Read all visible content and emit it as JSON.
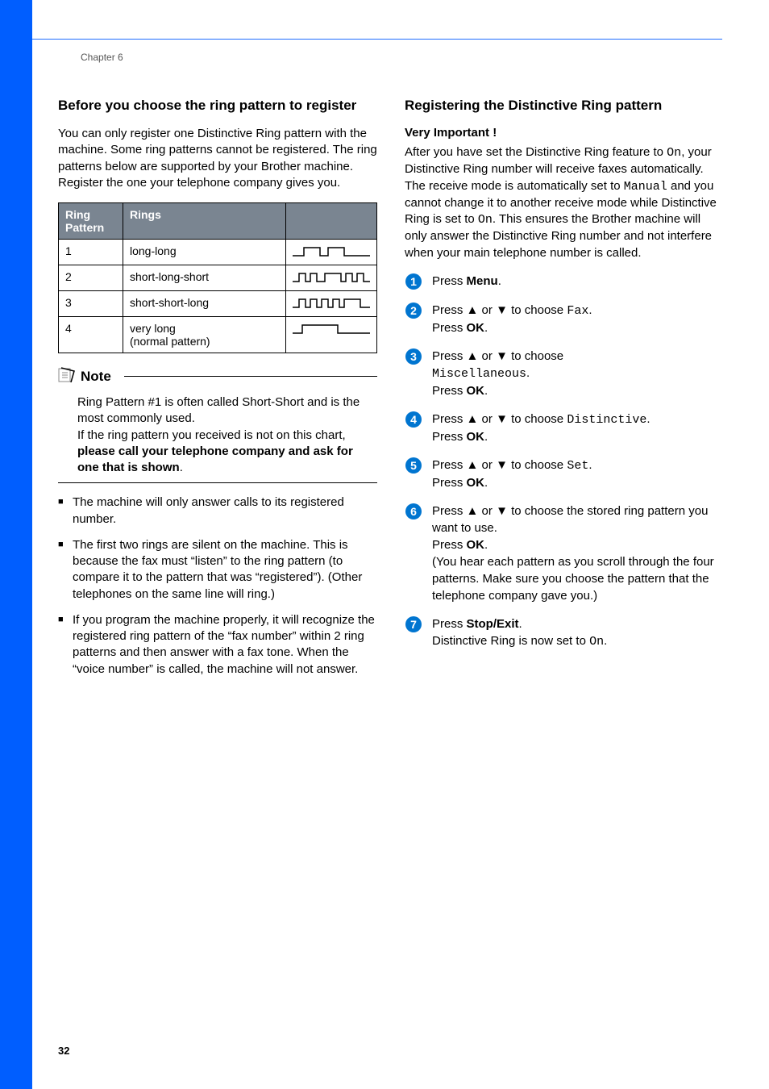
{
  "chapter": "Chapter 6",
  "page_number": "32",
  "left": {
    "heading": "Before you choose the ring pattern to register",
    "intro": "You can only register one Distinctive Ring pattern with the machine. Some ring patterns cannot be registered. The ring patterns below are supported by your Brother machine. Register the one your telephone company gives you.",
    "table": {
      "head_ring_pattern": "Ring Pattern",
      "head_rings": "Rings",
      "rows": [
        {
          "num": "1",
          "rings": "long-long"
        },
        {
          "num": "2",
          "rings": "short-long-short"
        },
        {
          "num": "3",
          "rings": "short-short-long"
        },
        {
          "num": "4",
          "rings": "very long\n(normal pattern)"
        }
      ]
    },
    "note": {
      "title": "Note",
      "line1": "Ring Pattern #1 is often called Short-Short and is the most commonly used.",
      "line2_pre": "If the ring pattern you received is not on this chart, ",
      "line2_bold": "please call your telephone company and ask for one that is shown",
      "line2_post": "."
    },
    "bullets": [
      "The machine will only answer calls to its registered number.",
      "The first two rings are silent on the machine. This is because the fax must “listen” to the ring pattern (to compare it to the pattern that was “registered”). (Other telephones on the same line will ring.)",
      "If you program the machine properly, it will recognize the registered ring pattern of the “fax number” within 2 ring patterns and then answer with a fax tone. When the “voice number” is called, the machine will not answer."
    ]
  },
  "right": {
    "heading": "Registering the Distinctive Ring pattern",
    "subheading": "Very Important !",
    "intro_pre1": "After you have set the Distinctive Ring feature to ",
    "intro_mono1": "On",
    "intro_mid1": ", your Distinctive Ring number will receive faxes automatically. The receive mode is automatically set to ",
    "intro_mono2": "Manual",
    "intro_mid2": " and you cannot change it to another receive mode while Distinctive Ring is set to ",
    "intro_mono3": "On",
    "intro_post": ". This ensures the Brother machine will only answer the Distinctive Ring number and not interfere when your main telephone number is called.",
    "steps": {
      "s1_pre": "Press ",
      "s1_bold": "Menu",
      "s1_post": ".",
      "s2_pre": "Press ",
      "s2_mid": " or ",
      "s2_mid2": " to choose ",
      "s2_mono": "Fax",
      "ok_pre": "Press ",
      "ok_bold": "OK",
      "ok_post": ".",
      "s3_mono": "Miscellaneous",
      "s3_post2": ".",
      "s4_mono": "Distinctive",
      "s5_mono": "Set",
      "s6_tail": " to choose the stored ring pattern you want to use.",
      "s6_paren": "(You hear each pattern as you scroll through the four patterns. Make sure you choose the pattern that the telephone company gave you.)",
      "s7_bold": "Stop/Exit",
      "s7_line2_pre": "Distinctive Ring is now set to ",
      "s7_mono": "On",
      "s7_line2_post": "."
    },
    "choose_word": " to choose "
  }
}
